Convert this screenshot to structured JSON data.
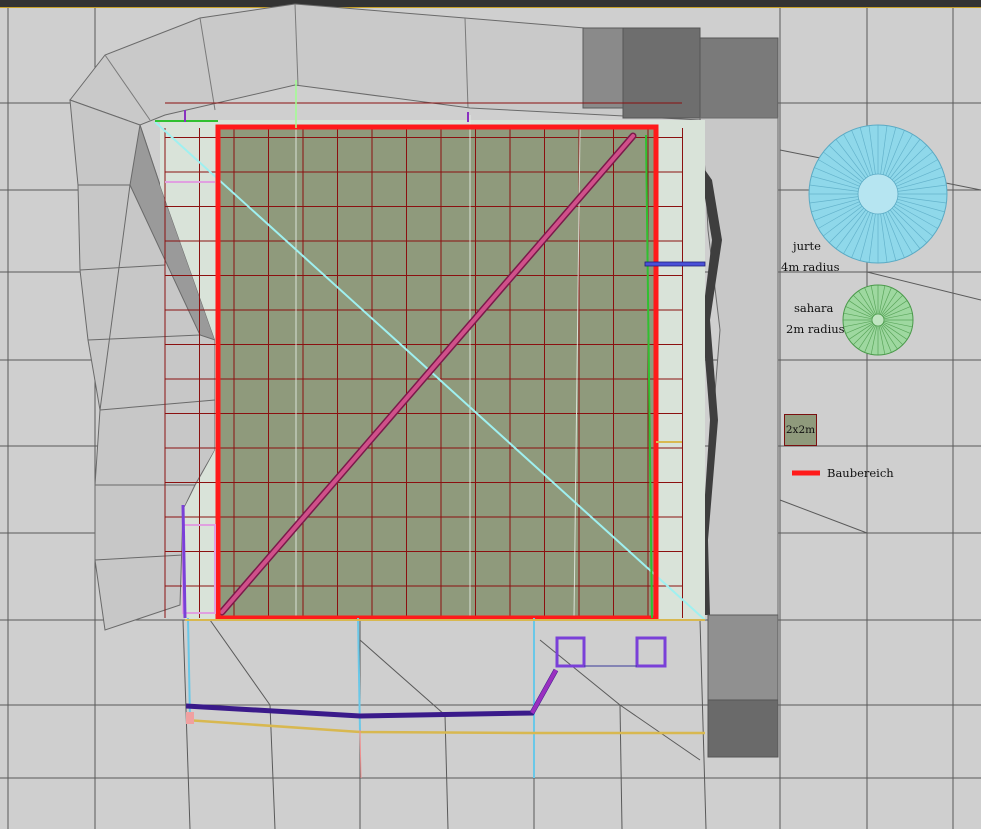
{
  "legend": {
    "jurte_name": "jurte",
    "jurte_radius": "4m radius",
    "sahara_name": "sahara",
    "sahara_radius": "2m radius",
    "plot_label": "2x2m",
    "build_area_label": "Baubereich"
  },
  "colors": {
    "background": "#cfcfcf",
    "wire": "#555555",
    "build_area": "#ff1a1a",
    "plot_fill": "#8f9a7c",
    "plot_grid": "#8b1010",
    "jurte": "#8fd8ea",
    "sahara": "#9ed8a0",
    "diagonal_cyan": "#9ff0f0",
    "diagonal_magenta": "#c0457a",
    "path_purple": "#4b1a9a",
    "path_yellow": "#d8b850"
  },
  "icons": [
    "jurte-tent-icon",
    "sahara-tent-icon",
    "plot-swatch-icon",
    "build-area-line-icon"
  ]
}
